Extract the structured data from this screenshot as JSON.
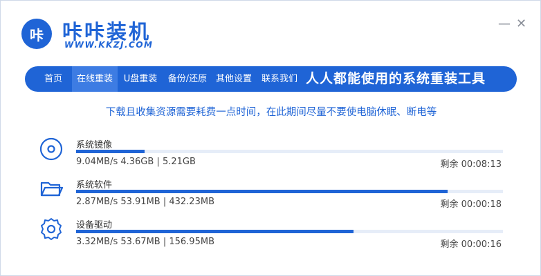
{
  "app": {
    "logo_glyph": "咔",
    "brand_name": "咔咔装机",
    "brand_url": "WWW.KKZJ.COM",
    "minimize_glyph": "—",
    "close_glyph": "✕"
  },
  "nav": {
    "items": [
      {
        "label": "首页",
        "active": false
      },
      {
        "label": "在线重装",
        "active": true
      },
      {
        "label": "U盘重装",
        "active": false
      },
      {
        "label": "备份/还原",
        "active": false
      },
      {
        "label": "其他设置",
        "active": false
      },
      {
        "label": "联系我们",
        "active": false
      }
    ],
    "slogan": "人人都能使用的系统重装工具"
  },
  "notice": "下载且收集资源需要耗费一点时间，在此期间尽量不要使电脑休眠、断电等",
  "downloads": [
    {
      "icon": "disc-icon",
      "label": "系统镜像",
      "progress": 0.16,
      "stats": "9.04MB/s 4.36GB | 5.21GB",
      "remaining": "剩余 00:08:13"
    },
    {
      "icon": "folder-icon",
      "label": "系统软件",
      "progress": 0.87,
      "stats": "2.87MB/s 53.91MB | 432.23MB",
      "remaining": "剩余 00:00:18"
    },
    {
      "icon": "gear-icon",
      "label": "设备驱动",
      "progress": 0.65,
      "stats": "3.32MB/s 53.67MB | 156.95MB",
      "remaining": "剩余 00:00:16"
    }
  ],
  "colors": {
    "accent": "#1f64d6",
    "track": "#e6edf8"
  }
}
